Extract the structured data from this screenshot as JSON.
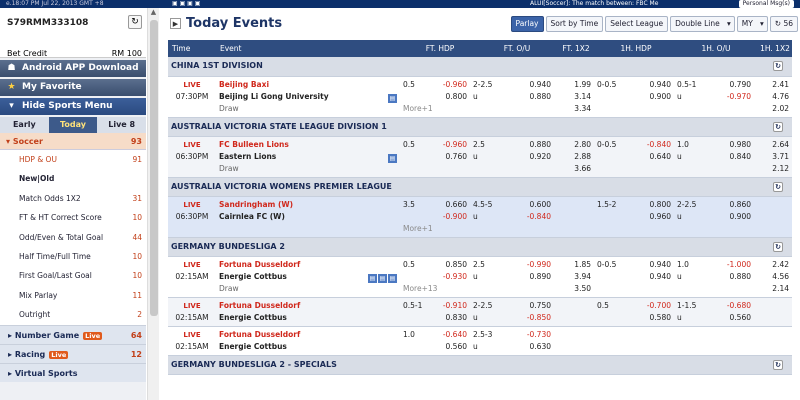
{
  "topbar": {
    "datetime": "e.18:07 PM Jul 22, 2013 GMT +8",
    "marquee": "ALUI[Soccer]: The match between: FBC Me",
    "personal": "Personal Msg(s)"
  },
  "account": {
    "id": "S79RMM333108",
    "credit_label": "Bet Credit",
    "credit_value": "RM 100"
  },
  "sidebar": {
    "android": "Android APP Download",
    "favorite": "My Favorite",
    "hide_menu": "Hide Sports Menu",
    "tabs": [
      "Early",
      "Today",
      "Live 8"
    ],
    "soccer": {
      "label": "Soccer",
      "count": "93"
    },
    "subs": [
      {
        "label": "HDP & OU",
        "count": "91"
      },
      {
        "label": "New|Old",
        "count": ""
      },
      {
        "label": "Match Odds 1X2",
        "count": "31"
      },
      {
        "label": "FT & HT Correct Score",
        "count": "10"
      },
      {
        "label": "Odd/Even & Total Goal",
        "count": "44"
      },
      {
        "label": "Half Time/Full Time",
        "count": "10"
      },
      {
        "label": "First Goal/Last Goal",
        "count": "10"
      },
      {
        "label": "Mix Parlay",
        "count": "11"
      },
      {
        "label": "Outright",
        "count": "2"
      }
    ],
    "groups": [
      {
        "label": "Number Game",
        "live": "Live",
        "count": "64"
      },
      {
        "label": "Racing",
        "live": "Live",
        "count": "12"
      },
      {
        "label": "Virtual Sports",
        "live": "",
        "count": ""
      }
    ]
  },
  "main": {
    "title": "Today Events",
    "controls": {
      "parlay": "Parlay",
      "sort": "Sort by Time",
      "league": "Select League",
      "line": "Double Line",
      "currency": "MY",
      "refresh": "56"
    },
    "headers": [
      "Time",
      "Event",
      "FT. HDP",
      "FT. O/U",
      "FT. 1X2",
      "1H. HDP",
      "1H. O/U",
      "1H. 1X2"
    ],
    "rows": [
      {
        "type": "league",
        "name": "CHINA 1ST DIVISION"
      },
      {
        "type": "event",
        "style": "",
        "live": "LIVE",
        "time": "07:30PM",
        "home": "Beijing Baxi",
        "away": "Beijing Li Gong University",
        "draw": "Draw",
        "icons": "1",
        "ft_hdp": {
          "line": "0.5",
          "h": "-0.960",
          "a": "0.800"
        },
        "ft_ou": {
          "line": "2-2.5",
          "u": "u",
          "o": "0.940",
          "un": "0.880"
        },
        "ft_1x2": [
          "1.99",
          "3.14",
          "3.34"
        ],
        "h1_hdp": {
          "line": "0-0.5",
          "h": "0.940",
          "a": "0.900"
        },
        "h1_ou": {
          "line": "0.5-1",
          "u": "u",
          "o": "0.790",
          "un": "-0.970"
        },
        "h1_1x2": [
          "2.41",
          "4.76",
          "2.02"
        ],
        "more": "More+1"
      },
      {
        "type": "league",
        "name": "AUSTRALIA VICTORIA STATE LEAGUE DIVISION 1"
      },
      {
        "type": "event",
        "style": "alt",
        "live": "LIVE",
        "time": "06:30PM",
        "home": "FC Bulleen Lions",
        "away": "Eastern Lions",
        "draw": "Draw",
        "icons": "1",
        "ft_hdp": {
          "line": "0.5",
          "h": "-0.960",
          "a": "0.760"
        },
        "ft_ou": {
          "line": "2.5",
          "u": "u",
          "o": "0.880",
          "un": "0.920"
        },
        "ft_1x2": [
          "2.80",
          "2.88",
          "3.66"
        ],
        "h1_hdp": {
          "line": "0-0.5",
          "h": "-0.840",
          "a": "0.640"
        },
        "h1_ou": {
          "line": "1.0",
          "u": "u",
          "o": "0.980",
          "un": "0.840"
        },
        "h1_1x2": [
          "2.64",
          "3.71",
          "2.12"
        ],
        "more": ""
      },
      {
        "type": "league",
        "name": "AUSTRALIA VICTORIA WOMENS PREMIER LEAGUE"
      },
      {
        "type": "event",
        "style": "blue",
        "live": "LIVE",
        "time": "06:30PM",
        "home": "Sandringham (W)",
        "away": "Cairnlea FC (W)",
        "draw": "",
        "icons": "",
        "ft_hdp": {
          "line": "3.5",
          "h": "0.660",
          "a": "-0.900"
        },
        "ft_ou": {
          "line": "4.5-5",
          "u": "u",
          "o": "0.600",
          "un": "-0.840"
        },
        "ft_1x2": [
          "",
          "",
          ""
        ],
        "h1_hdp": {
          "line": "1.5-2",
          "h": "0.800",
          "a": "0.960"
        },
        "h1_ou": {
          "line": "2-2.5",
          "u": "u",
          "o": "0.860",
          "un": "0.900"
        },
        "h1_1x2": [
          "",
          "",
          ""
        ],
        "more": "More+1"
      },
      {
        "type": "league",
        "name": "GERMANY BUNDESLIGA 2"
      },
      {
        "type": "event",
        "style": "",
        "live": "LIVE",
        "time": "02:15AM",
        "home": "Fortuna Dusseldorf",
        "away": "Energie Cottbus",
        "draw": "Draw",
        "icons": "3",
        "ft_hdp": {
          "line": "0.5",
          "h": "0.850",
          "a": "-0.930"
        },
        "ft_ou": {
          "line": "2.5",
          "u": "u",
          "o": "-0.990",
          "un": "0.890"
        },
        "ft_1x2": [
          "1.85",
          "3.94",
          "3.50"
        ],
        "h1_hdp": {
          "line": "0-0.5",
          "h": "0.940",
          "a": "0.940"
        },
        "h1_ou": {
          "line": "1.0",
          "u": "u",
          "o": "-1.000",
          "un": "0.880"
        },
        "h1_1x2": [
          "2.42",
          "4.56",
          "2.14"
        ],
        "more": "More+13"
      },
      {
        "type": "event",
        "style": "alt",
        "live": "LIVE",
        "time": "02:15AM",
        "home": "Fortuna Dusseldorf",
        "away": "Energie Cottbus",
        "draw": "",
        "icons": "",
        "ft_hdp": {
          "line": "0.5-1",
          "h": "-0.910",
          "a": "0.830"
        },
        "ft_ou": {
          "line": "2-2.5",
          "u": "u",
          "o": "0.750",
          "un": "-0.850"
        },
        "ft_1x2": [
          "",
          "",
          ""
        ],
        "h1_hdp": {
          "line": "0.5",
          "h": "-0.700",
          "a": "0.580"
        },
        "h1_ou": {
          "line": "1-1.5",
          "u": "u",
          "o": "-0.680",
          "un": "0.560"
        },
        "h1_1x2": [
          "",
          "",
          ""
        ],
        "more": ""
      },
      {
        "type": "event",
        "style": "",
        "live": "LIVE",
        "time": "02:15AM",
        "home": "Fortuna Dusseldorf",
        "away": "Energie Cottbus",
        "draw": "",
        "icons": "",
        "ft_hdp": {
          "line": "1.0",
          "h": "-0.640",
          "a": "0.560"
        },
        "ft_ou": {
          "line": "2.5-3",
          "u": "u",
          "o": "-0.730",
          "un": "0.630"
        },
        "ft_1x2": [
          "",
          "",
          ""
        ],
        "h1_hdp": {
          "line": "",
          "h": "",
          "a": ""
        },
        "h1_ou": {
          "line": "",
          "u": "",
          "o": "",
          "un": ""
        },
        "h1_1x2": [
          "",
          "",
          ""
        ],
        "more": ""
      },
      {
        "type": "league",
        "name": "GERMANY BUNDESLIGA 2 - SPECIALS"
      }
    ]
  }
}
